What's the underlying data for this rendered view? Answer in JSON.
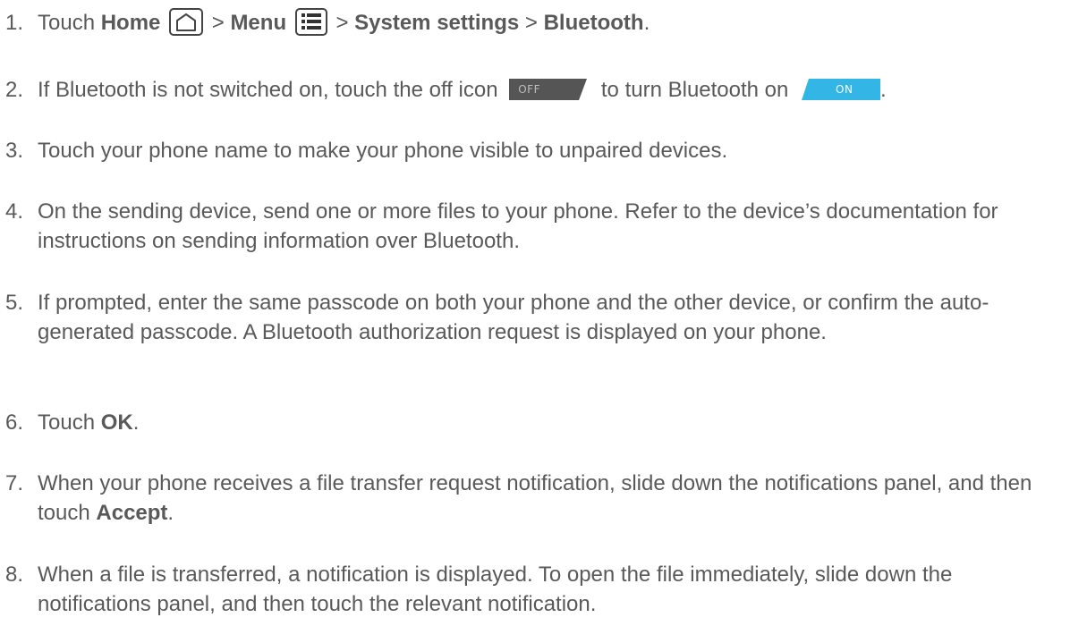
{
  "steps": [
    {
      "num": "1.",
      "t1": "Touch ",
      "b1": "Home",
      "t2": " > ",
      "b2": "Menu",
      "t3": " > ",
      "b3": "System settings",
      "t4": " > ",
      "b4": "Bluetooth",
      "t5": "."
    },
    {
      "num": "2.",
      "t1": "If Bluetooth is not switched on, touch the off icon",
      "off_label": "OFF",
      "t2": "to turn Bluetooth on",
      "on_label": "ON",
      "t3": "."
    },
    {
      "num": "3.",
      "text": "Touch your phone name to make your phone visible to unpaired devices."
    },
    {
      "num": "4.",
      "text": "On the sending device, send one or more files to your phone. Refer to the device’s documentation for instructions on sending information over Bluetooth."
    },
    {
      "num": "5.",
      "text": "If prompted, enter the same passcode on both your phone and the other device, or confirm the auto-generated passcode. A Bluetooth authorization request is displayed on your phone."
    },
    {
      "num": "6.",
      "t1": "Touch ",
      "b1": "OK",
      "t2": "."
    },
    {
      "num": "7.",
      "t1": "When your phone receives a file transfer request notification, slide down the notifications panel, and then touch ",
      "b1": "Accept",
      "t2": "."
    },
    {
      "num": "8.",
      "text": "When a file is transferred, a notification is displayed. To open the file immediately, slide down the notifications panel, and then touch the relevant notification."
    }
  ],
  "icons": {
    "home": "home-icon",
    "menu": "menu-icon",
    "off_toggle": "off-toggle-icon",
    "on_toggle": "on-toggle-icon"
  },
  "colors": {
    "text": "#595959",
    "toggle_off_bg": "#555555",
    "toggle_on_bg": "#33b5e5"
  }
}
